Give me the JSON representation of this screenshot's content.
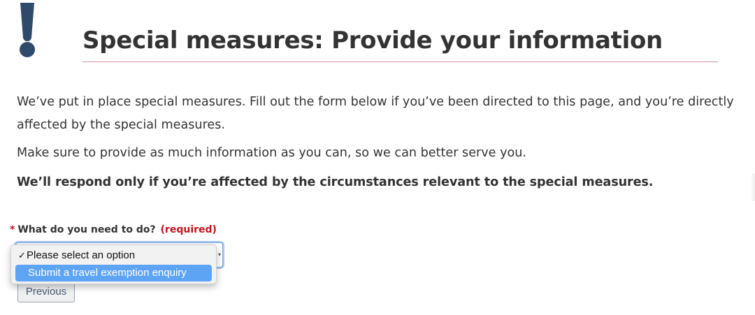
{
  "header": {
    "title": "Special measures: Provide your information",
    "icon": "exclamation-icon",
    "icon_color": "#2f4a6b",
    "rule_color": "#d5939d"
  },
  "intro": {
    "paragraph_1": "We’ve put in place special measures. Fill out the form below if you’ve been directed to this page, and you’re directly affected by the special measures.",
    "paragraph_2": "Make sure to provide as much information as you can, so we can better serve you.",
    "paragraph_3": "We’ll respond only if you’re affected by the circumstances relevant to the special measures."
  },
  "form": {
    "question": {
      "asterisk": "*",
      "label": "What do you need to do?",
      "required_text": "(required)",
      "required_color": "#c0141c"
    },
    "select": {
      "options": [
        {
          "check": "✓",
          "label": "Please select an option",
          "selected": true
        },
        {
          "label": "Submit a travel exemption enquiry",
          "highlighted": true
        }
      ],
      "highlight_color": "#5ea4f5"
    },
    "previous_label": "Previous"
  }
}
